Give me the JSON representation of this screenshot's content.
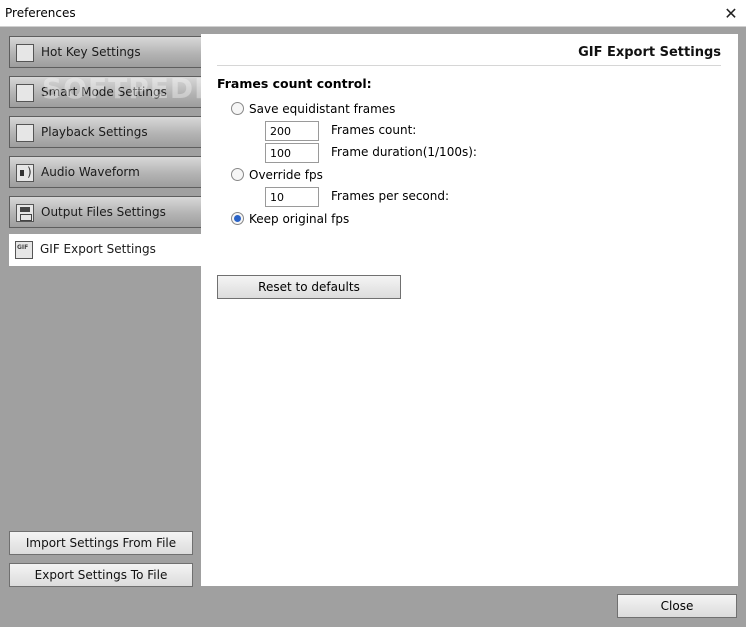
{
  "window": {
    "title": "Preferences",
    "close_glyph": "✕"
  },
  "sidebar": {
    "items": [
      {
        "label": "Hot Key Settings",
        "icon": "keyboard-icon",
        "active": false
      },
      {
        "label": "Smart Mode Settings",
        "icon": "film-icon",
        "active": false
      },
      {
        "label": "Playback Settings",
        "icon": "film-icon",
        "active": false
      },
      {
        "label": "Audio Waveform",
        "icon": "speaker-icon",
        "active": false
      },
      {
        "label": "Output Files Settings",
        "icon": "disk-icon",
        "active": false
      },
      {
        "label": "GIF Export Settings",
        "icon": "gif-icon",
        "active": true
      }
    ],
    "watermark": "SOFTPEDIA",
    "import_label": "Import Settings From File",
    "export_label": "Export Settings To File"
  },
  "content": {
    "heading": "GIF Export Settings",
    "section_label": "Frames count control:",
    "options": {
      "equidistant": {
        "label": "Save equidistant frames",
        "checked": false
      },
      "override": {
        "label": "Override fps",
        "checked": false
      },
      "original": {
        "label": "Keep original fps",
        "checked": true
      }
    },
    "fields": {
      "frames_count": {
        "value": "200",
        "label": "Frames count:"
      },
      "frame_duration": {
        "value": "100",
        "label": "Frame duration(1/100s):"
      },
      "fps": {
        "value": "10",
        "label": "Frames per second:"
      }
    },
    "reset_label": "Reset to defaults"
  },
  "footer": {
    "close_label": "Close"
  },
  "colors": {
    "accent": "#2a63c7",
    "panel": "#a0a0a0",
    "content_bg": "#ffffff"
  }
}
